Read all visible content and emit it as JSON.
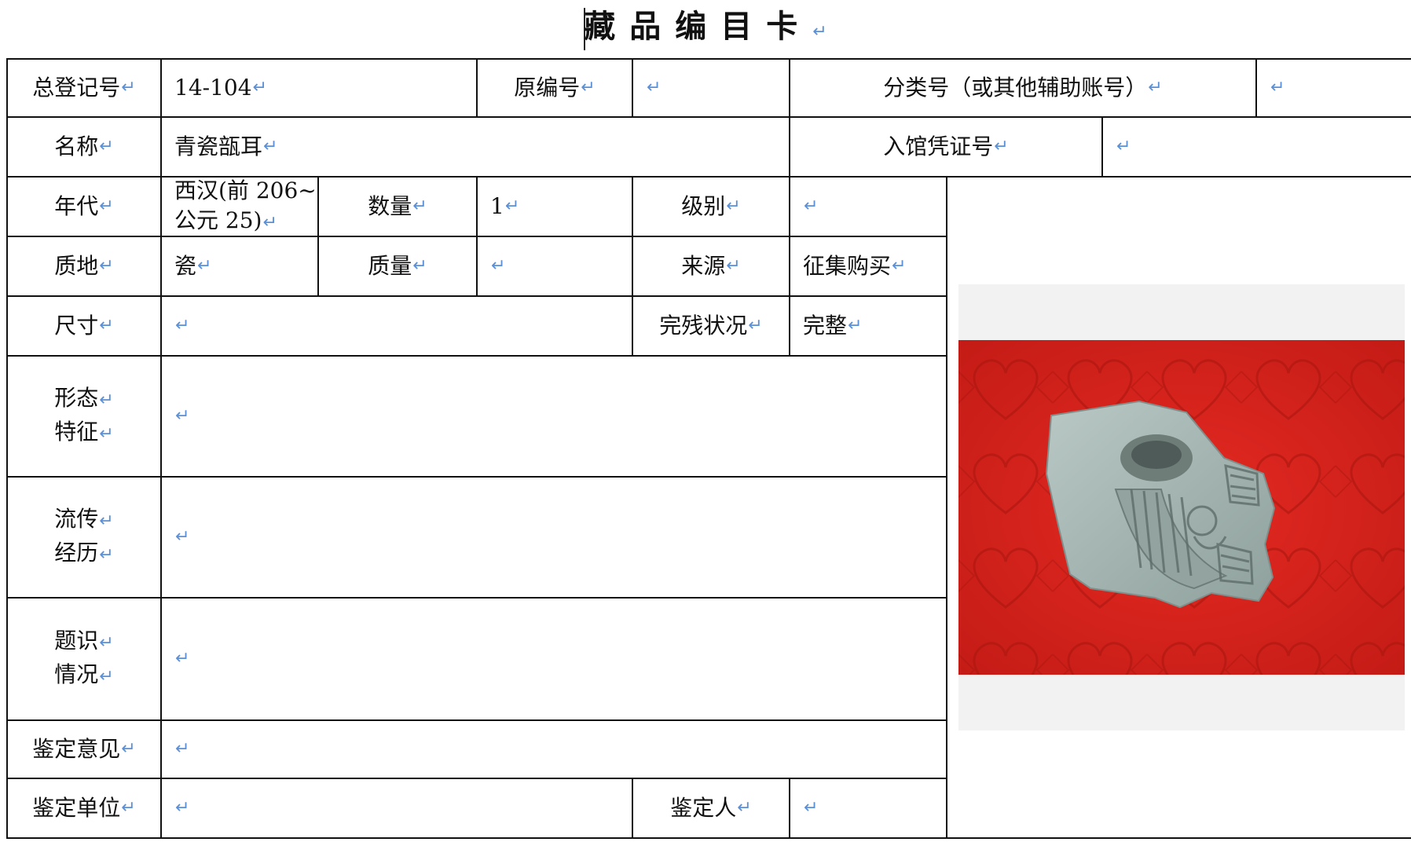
{
  "card": {
    "title": "藏品编目卡"
  },
  "mark": "↵",
  "fields": {
    "total_reg_no_label": "总登记号",
    "total_reg_no_value": "14-104",
    "orig_no_label": "原编号",
    "orig_no_value": "",
    "class_no_label": "分类号（或其他辅助账号）",
    "class_no_value": "",
    "name_label": "名称",
    "name_value": "青瓷瓿耳",
    "entry_voucher_label": "入馆凭证号",
    "entry_voucher_value": "",
    "era_label": "年代",
    "era_value_line1": "西汉(前 206~",
    "era_value_line2": "公元 25)",
    "quantity_label": "数量",
    "quantity_value": "1",
    "grade_label": "级别",
    "grade_value": "",
    "material_label": "质地",
    "material_value": "瓷",
    "mass_label": "质量",
    "mass_value": "",
    "source_label": "来源",
    "source_value": "征集购买",
    "size_label": "尺寸",
    "size_value": "",
    "condition_label": "完残状况",
    "condition_value": "完整",
    "form_label_line1": "形态",
    "form_label_line2": "特征",
    "form_value": "",
    "history_label_line1": "流传",
    "history_label_line2": "经历",
    "history_value": "",
    "inscription_label_line1": "题识",
    "inscription_label_line2": "情况",
    "inscription_value": "",
    "appraisal_opinion_label": "鉴定意见",
    "appraisal_opinion_value": "",
    "appraisal_unit_label": "鉴定单位",
    "appraisal_unit_value": "",
    "appraiser_label": "鉴定人",
    "appraiser_value": ""
  },
  "colors": {
    "pilcrow": "#5b8fd6",
    "grid": "#111111",
    "felt": "#d7221c",
    "ceramic": "#9fb1ad"
  }
}
